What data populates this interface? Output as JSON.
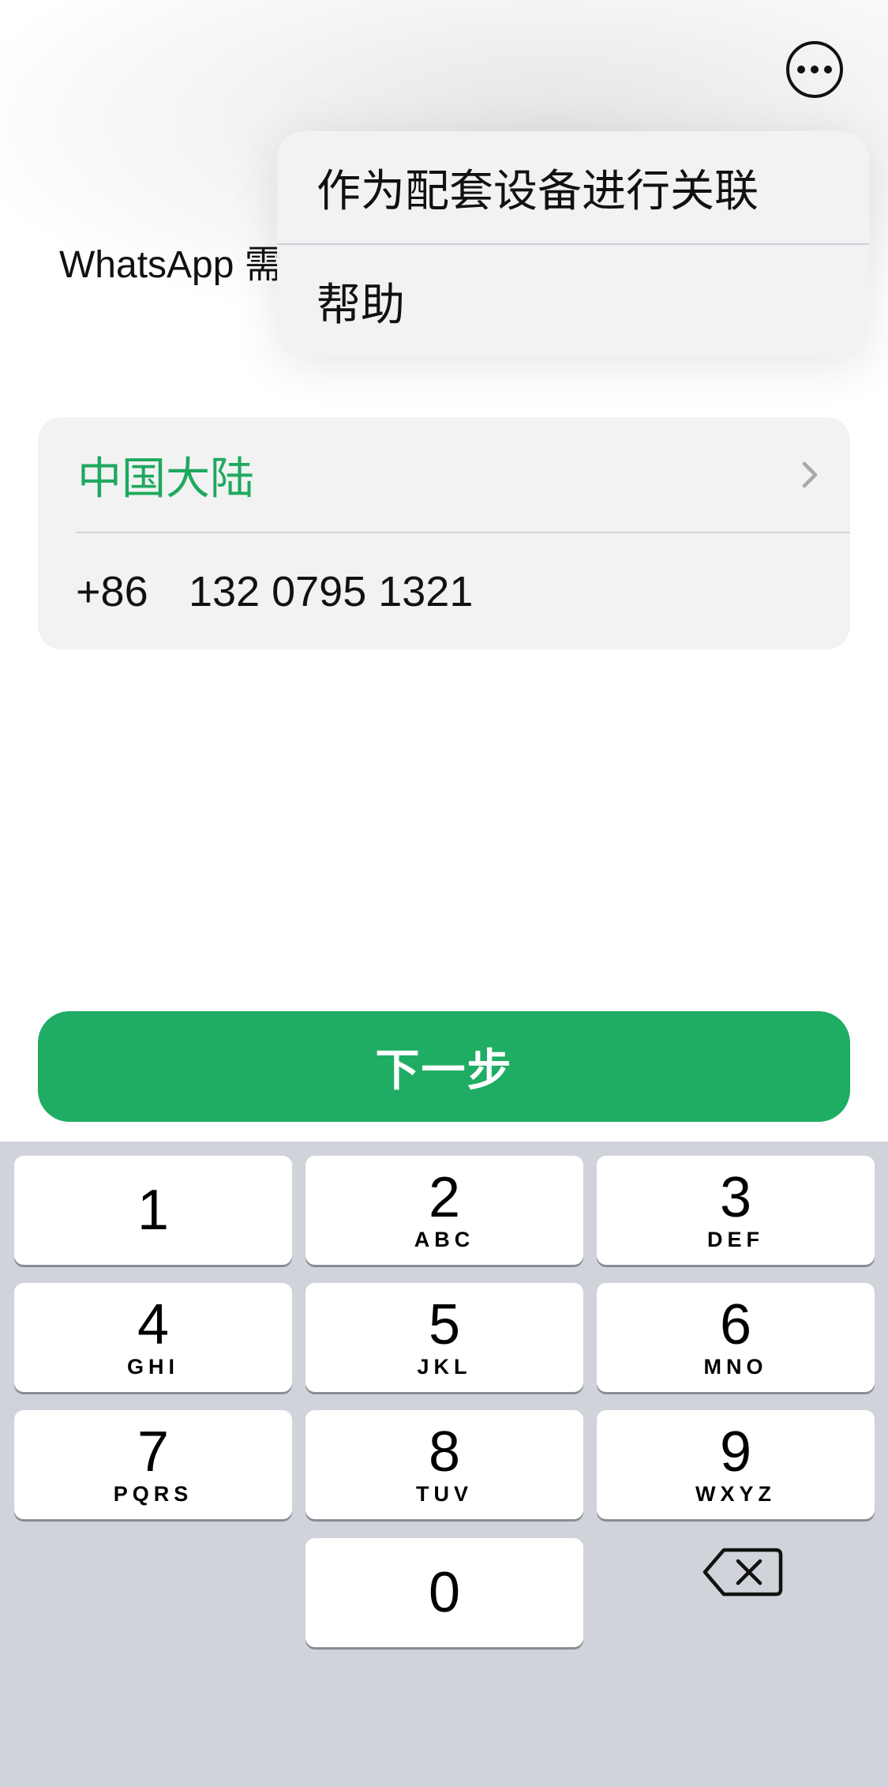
{
  "header": {
    "more_icon": "ellipsis-circle-icon",
    "intro_text": "WhatsApp 需"
  },
  "menu": {
    "items": [
      {
        "label": "作为配套设备进行关联"
      },
      {
        "label": "帮助"
      }
    ]
  },
  "phone_card": {
    "country": "中国大陆",
    "chevron_icon": "chevron-right-icon",
    "country_code": "+86",
    "phone_number": "132 0795 1321"
  },
  "next_button": {
    "label": "下一步"
  },
  "keypad": {
    "keys": [
      {
        "digit": "1",
        "letters": ""
      },
      {
        "digit": "2",
        "letters": "ABC"
      },
      {
        "digit": "3",
        "letters": "DEF"
      },
      {
        "digit": "4",
        "letters": "GHI"
      },
      {
        "digit": "5",
        "letters": "JKL"
      },
      {
        "digit": "6",
        "letters": "MNO"
      },
      {
        "digit": "7",
        "letters": "PQRS"
      },
      {
        "digit": "8",
        "letters": "TUV"
      },
      {
        "digit": "9",
        "letters": "WXYZ"
      },
      {
        "digit": "0",
        "letters": ""
      }
    ],
    "delete_icon": "backspace-icon"
  },
  "colors": {
    "accent_green": "#1fad64",
    "country_text_green": "#1fa95e",
    "keyboard_background": "#d1d3db",
    "card_background": "#f2f2f3"
  }
}
